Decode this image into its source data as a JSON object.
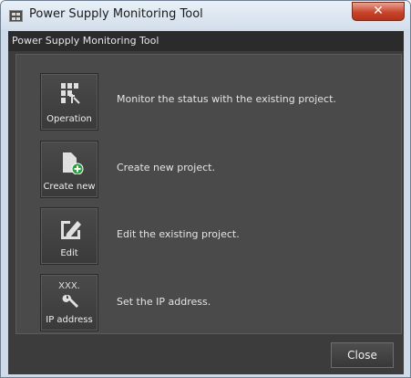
{
  "window": {
    "title": "Power Supply Monitoring Tool"
  },
  "header": {
    "title": "Power Supply Monitoring Tool"
  },
  "menu": [
    {
      "label": "Operation",
      "description": "Monitor the status with the existing project.",
      "icon": "operation-icon"
    },
    {
      "label": "Create new",
      "description": "Create new project.",
      "icon": "new-document-plus-icon"
    },
    {
      "label": "Edit",
      "description": "Edit the existing project.",
      "icon": "pencil-edit-icon"
    },
    {
      "label": "IP address",
      "description": "Set the IP address.",
      "icon": "wrench-ip-icon",
      "icon_text": "XXX."
    }
  ],
  "footer": {
    "close_label": "Close"
  },
  "colors": {
    "background": "#3c3c3c",
    "panel": "#4a4a4a",
    "title_bar": "#d3dfec",
    "close_x": "#c9452c"
  }
}
